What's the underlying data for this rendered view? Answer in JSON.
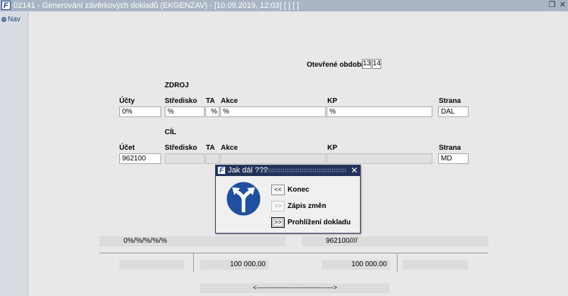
{
  "window": {
    "title": "02141 - Generování závěrkových dokladů (EKGENZAV) - [10.09.2019, 12:03]  [ ]  [ ]",
    "restore_glyph": "❐",
    "close_glyph": "✕"
  },
  "nav": {
    "label": "Nav"
  },
  "period": {
    "label": "Otevřené období",
    "values": [
      "13",
      "14"
    ]
  },
  "zdroj": {
    "heading": "ZDROJ",
    "labels": {
      "ucty": "Účty",
      "stredisko": "Středisko",
      "ta": "TA",
      "akce": "Akce",
      "kp": "KP",
      "strana": "Strana"
    },
    "values": {
      "ucty": "0%",
      "stredisko": "%",
      "ta": "%",
      "akce": "%",
      "kp": "%",
      "strana": "DAL"
    }
  },
  "cil": {
    "heading": "CÍL",
    "labels": {
      "ucet": "Účet",
      "stredisko": "Středisko",
      "ta": "TA",
      "akce": "Akce",
      "kp": "KP",
      "strana": "Strana"
    },
    "values": {
      "ucet": "962100",
      "stredisko": "",
      "ta": "",
      "akce": "",
      "kp": "",
      "strana": "MD"
    }
  },
  "dialog": {
    "title": "Jak dál ???",
    "close_glyph": "✕",
    "icon": "fork-arrows-icon",
    "buttons": [
      {
        "glyph": "<<",
        "label": "Konec",
        "enabled": true
      },
      {
        "glyph": ">>",
        "label": "Zápis změn",
        "enabled": false
      },
      {
        "glyph": ">>",
        "label": "Prohlížení dokladu",
        "enabled": true
      }
    ]
  },
  "summary": {
    "source_mask": "0%/%/%/%/%",
    "target_mask": "962100////",
    "amount_left": "100 000.00",
    "amount_right": "100 000.00",
    "arrow": "<------------------------------------>"
  },
  "colors": {
    "titlebar": "#a9b5c4",
    "dialog_title": "#233259",
    "sign": "#1f4fa0"
  }
}
